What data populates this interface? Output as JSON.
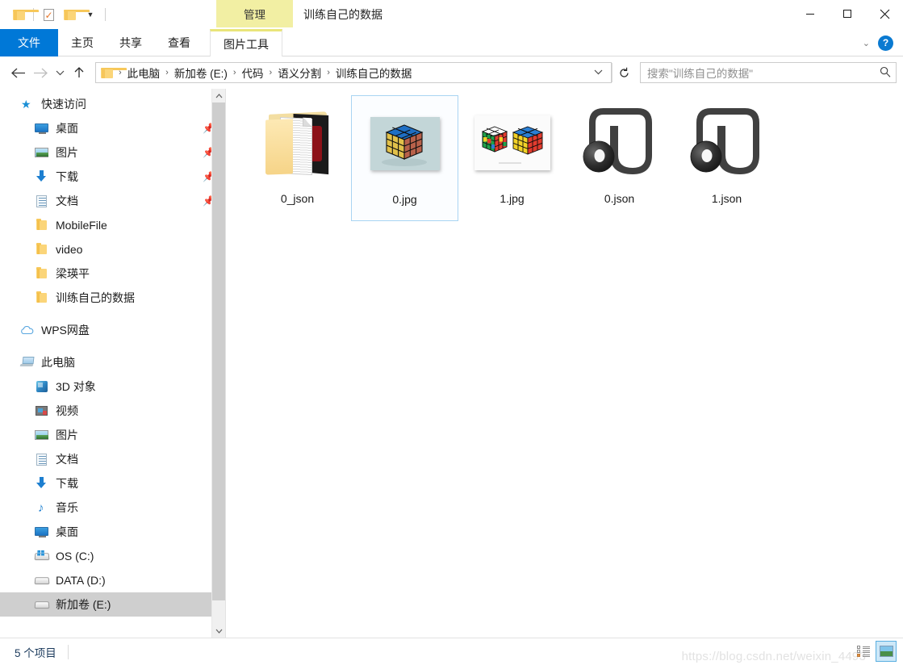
{
  "titlebar": {
    "quick_access": [
      {
        "name": "folder-icon",
        "label": "文件夹"
      },
      {
        "name": "properties-icon",
        "label": "属性"
      },
      {
        "name": "new-folder-icon",
        "label": "新建文件夹"
      },
      {
        "name": "customize-caret-icon",
        "label": "⌄"
      }
    ],
    "contextual_tab": "管理",
    "window_title": "训练自己的数据",
    "minimize": "—",
    "maximize": "☐",
    "close": "✕"
  },
  "ribbon": {
    "tabs": [
      {
        "label": "文件",
        "active": true
      },
      {
        "label": "主页",
        "active": false
      },
      {
        "label": "共享",
        "active": false
      },
      {
        "label": "查看",
        "active": false
      },
      {
        "label": "图片工具",
        "active": false,
        "contextual": true
      }
    ],
    "collapse_caret": "⌄",
    "help_label": "?"
  },
  "addressbar": {
    "back": "←",
    "forward": "→",
    "recent_caret": "⌄",
    "up": "↑",
    "breadcrumb": [
      "此电脑",
      "新加卷 (E:)",
      "代码",
      "语义分割",
      "训练自己的数据"
    ],
    "breadcrumb_separator": "›",
    "dropdown_caret": "⌄",
    "refresh": "↻",
    "search_placeholder": "搜索\"训练自己的数据\"",
    "search_value": ""
  },
  "sidebar": {
    "quick_access": {
      "title": "快速访问",
      "items": [
        {
          "label": "桌面",
          "icon": "monitor-icon",
          "pinned": true
        },
        {
          "label": "图片",
          "icon": "picture-icon",
          "pinned": true
        },
        {
          "label": "下载",
          "icon": "download-icon",
          "pinned": true
        },
        {
          "label": "文档",
          "icon": "document-icon",
          "pinned": true
        },
        {
          "label": "MobileFile",
          "icon": "folder-icon",
          "pinned": false
        },
        {
          "label": "video",
          "icon": "folder-icon",
          "pinned": false
        },
        {
          "label": "梁瑛平",
          "icon": "folder-icon",
          "pinned": false
        },
        {
          "label": "训练自己的数据",
          "icon": "folder-icon",
          "pinned": false
        }
      ]
    },
    "wps": {
      "label": "WPS网盘",
      "icon": "cloud-icon"
    },
    "this_pc": {
      "title": "此电脑",
      "items": [
        {
          "label": "3D 对象",
          "icon": "3d-object-icon"
        },
        {
          "label": "视频",
          "icon": "video-icon"
        },
        {
          "label": "图片",
          "icon": "picture-icon"
        },
        {
          "label": "文档",
          "icon": "document-icon"
        },
        {
          "label": "下载",
          "icon": "download-icon"
        },
        {
          "label": "音乐",
          "icon": "music-icon"
        },
        {
          "label": "桌面",
          "icon": "monitor-icon"
        },
        {
          "label": "OS (C:)",
          "icon": "os-drive-icon"
        },
        {
          "label": "DATA (D:)",
          "icon": "drive-icon"
        },
        {
          "label": "新加卷 (E:)",
          "icon": "drive-icon",
          "selected": true
        }
      ]
    },
    "scrollbar": {
      "up": "⌃",
      "down": "⌄"
    }
  },
  "files": [
    {
      "name": "0_json",
      "type": "folder-with-document",
      "selected": false
    },
    {
      "name": "0.jpg",
      "type": "image-single-cube",
      "selected": true
    },
    {
      "name": "1.jpg",
      "type": "image-two-cubes",
      "selected": false
    },
    {
      "name": "0.json",
      "type": "json-file",
      "selected": false
    },
    {
      "name": "1.json",
      "type": "json-file",
      "selected": false
    }
  ],
  "watermark": "https://blog.csdn.net/weixin_4493",
  "statusbar": {
    "item_count": "5 个项目",
    "view_details": "详细信息",
    "view_large_icons": "大图标"
  },
  "colors": {
    "accent": "#0078d7",
    "contextual_tab_bg": "#f2efa3",
    "selection_bg": "#cfcfcf",
    "selected_item_border": "#a9d4f2"
  }
}
